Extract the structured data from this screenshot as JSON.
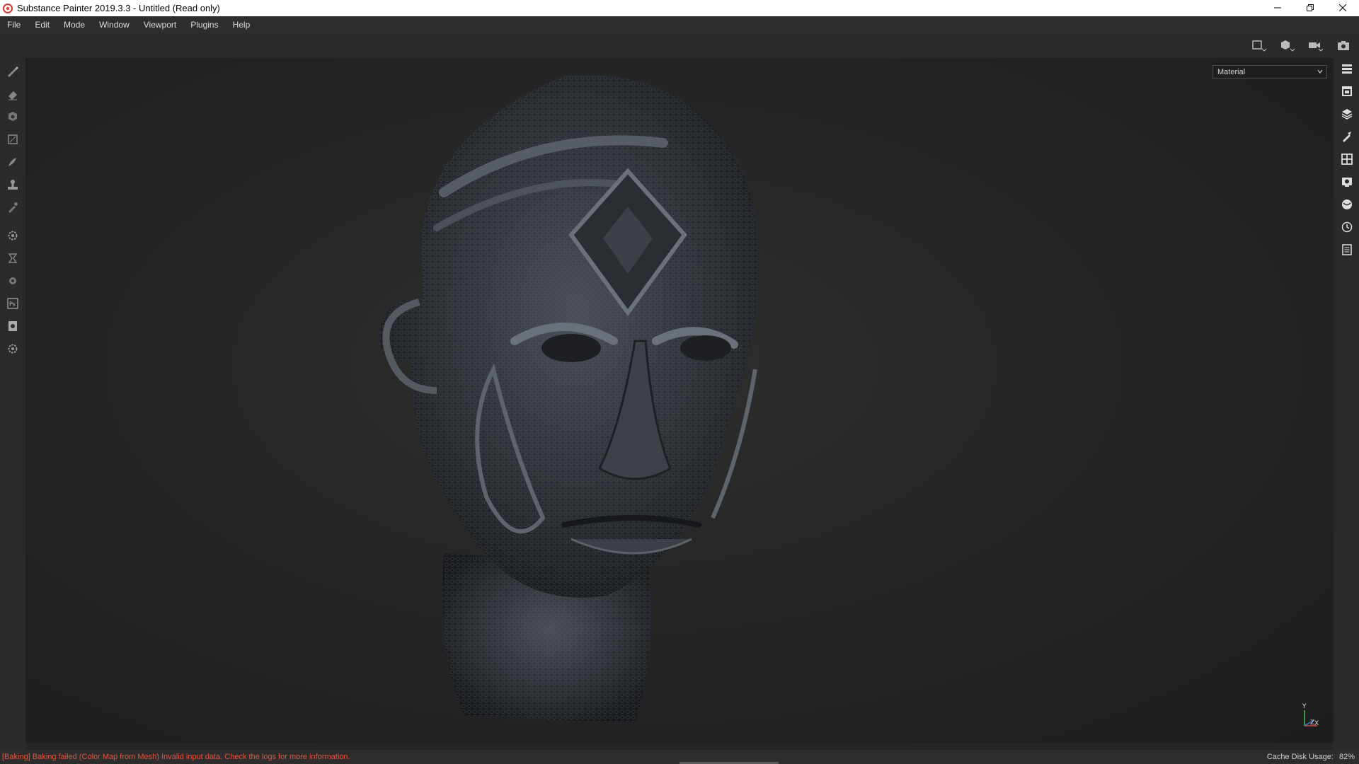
{
  "window": {
    "title": "Substance Painter 2019.3.3 - Untitled (Read only)",
    "controls": [
      "minimize-icon",
      "restore-icon",
      "close-icon"
    ]
  },
  "menu": {
    "items": [
      "File",
      "Edit",
      "Mode",
      "Window",
      "Viewport",
      "Plugins",
      "Help"
    ]
  },
  "viewport_toolbar": {
    "icons": [
      "view-mode-icon",
      "camera-cube-icon",
      "camera-icon",
      "screenshot-icon"
    ]
  },
  "left_toolbar": {
    "icons": [
      "paint-brush-icon",
      "eraser-icon",
      "projection-icon",
      "geometry-mask-icon",
      "smudge-icon",
      "clone-stamp-icon",
      "color-picker-icon",
      "settings-icon",
      "bake-icon",
      "substance-icon",
      "photoshop-icon",
      "export-icon",
      "plugin-icon"
    ]
  },
  "right_toolbar": {
    "icons": [
      "layers-list-icon",
      "texture-set-icon",
      "layer-stack-icon",
      "properties-icon",
      "display-settings-icon",
      "viewer-settings-icon",
      "shelf-icon",
      "history-icon",
      "log-icon"
    ]
  },
  "viewport": {
    "channel": "Material",
    "axis_labels": {
      "y": "Y",
      "z": "Z",
      "x": "X"
    }
  },
  "status": {
    "message": "[Baking] Baking failed (Color Map from Mesh) Invalid input data. Check the logs for more information.",
    "cache_label": "Cache Disk Usage:",
    "cache_value": "82%"
  },
  "colors": {
    "error": "#e0553f",
    "background": "#2b2b2b"
  }
}
